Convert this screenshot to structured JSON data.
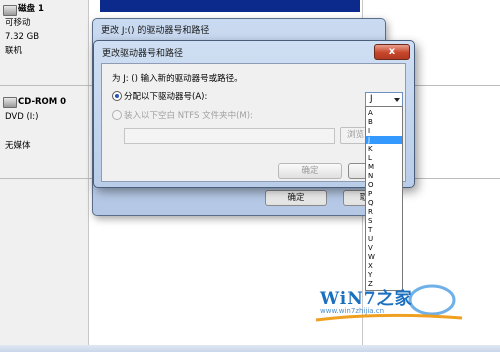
{
  "background": {
    "disk1": {
      "name": "磁盘 1",
      "type": "可移动",
      "size": "7.32 GB",
      "status": "联机"
    },
    "cdrom": {
      "name": "CD-ROM 0",
      "type": "DVD (I:)",
      "status": "无媒体"
    }
  },
  "outer_dialog": {
    "title": "更改 J:() 的驱动器号和路径",
    "ok_label": "确定",
    "cancel_label": "取"
  },
  "inner_dialog": {
    "title": "更改驱动器号和路径",
    "close_label": "x",
    "prompt": "为 J: () 输入新的驱动器号或路径。",
    "option_assign": "分配以下驱动器号(A):",
    "option_mount": "装入以下空白 NTFS 文件夹中(M):",
    "path_value": "",
    "browse_label": "浏览",
    "ok_label": "确定",
    "cancel_label": "取"
  },
  "drive_combo": {
    "selected": "J",
    "options": [
      "A",
      "B",
      "I",
      "J",
      "K",
      "L",
      "M",
      "N",
      "O",
      "P",
      "Q",
      "R",
      "S",
      "T",
      "U",
      "V",
      "W",
      "X",
      "Y",
      "Z"
    ]
  },
  "watermark": {
    "brand": "WiN7之家",
    "url": "www.win7zhijia.cn"
  },
  "colors": {
    "dialog_blue": "#c9daf1",
    "selection": "#3399ff",
    "close_red": "#c7452b"
  }
}
